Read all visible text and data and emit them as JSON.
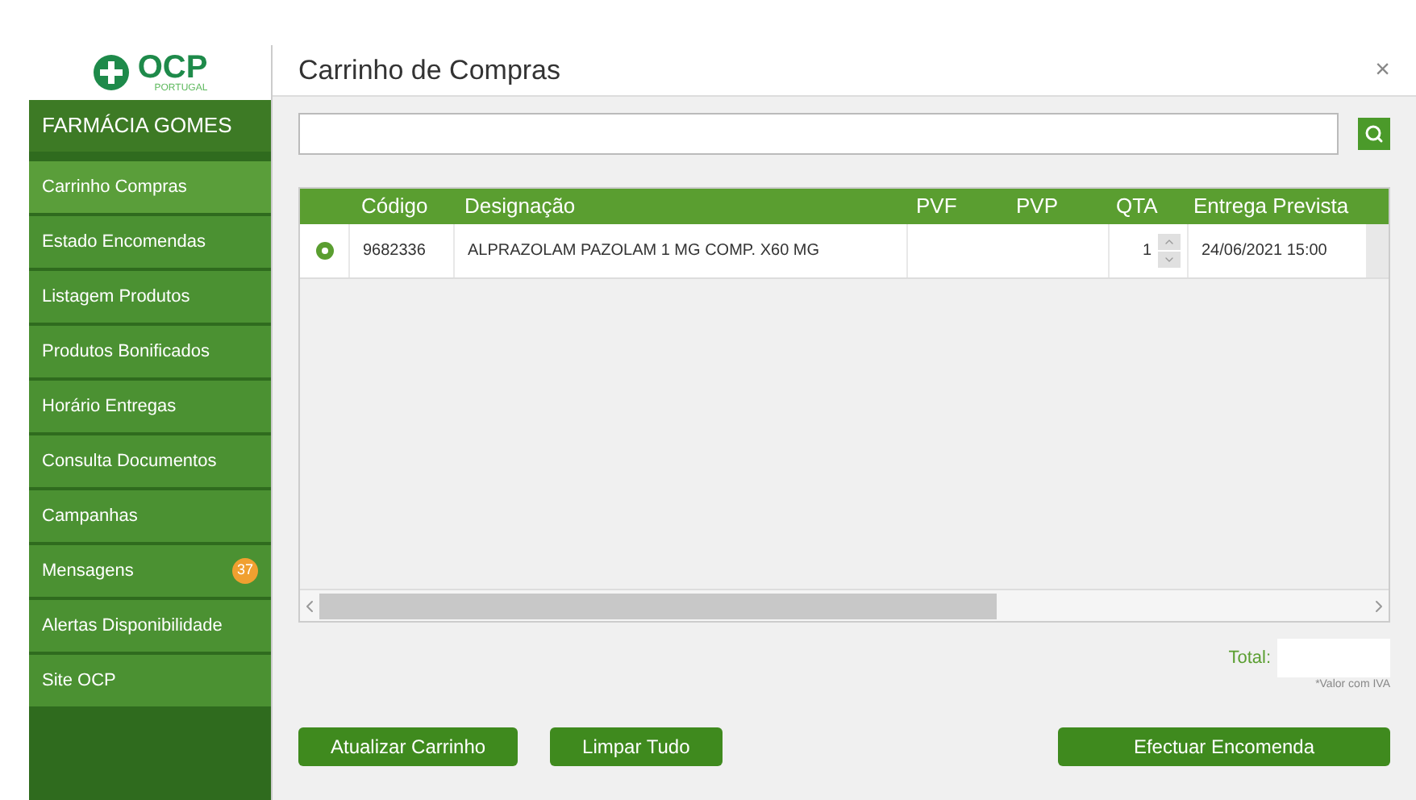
{
  "sidebar": {
    "logo": "OCP",
    "logo_sub": "PORTUGAL",
    "pharmacy": "FARMÁCIA GOMES",
    "items": [
      {
        "label": "Carrinho Compras",
        "selected": true
      },
      {
        "label": "Estado Encomendas",
        "selected": false
      },
      {
        "label": "Listagem Produtos",
        "selected": false
      },
      {
        "label": "Produtos Bonificados",
        "selected": false
      },
      {
        "label": "Horário Entregas",
        "selected": false
      },
      {
        "label": "Consulta Documentos",
        "selected": false
      },
      {
        "label": "Campanhas",
        "selected": false
      },
      {
        "label": "Mensagens",
        "selected": false,
        "badge": "37"
      },
      {
        "label": "Alertas Disponibilidade",
        "selected": false
      },
      {
        "label": "Site OCP",
        "selected": false
      }
    ]
  },
  "dialog": {
    "title": "Carrinho de Compras",
    "close": "×"
  },
  "table": {
    "columns": [
      "Código",
      "Designação",
      "PVF",
      "PVP",
      "QTA",
      "Entrega Prevista"
    ],
    "rows": [
      {
        "code": "9682336",
        "name": "ALPRAZOLAM PAZOLAM 1 MG COMP. X60 MG",
        "qty": "1",
        "delivery": "24/06/2021 15:00"
      }
    ]
  },
  "total": {
    "label": "Total:",
    "note": "*Valor com IVA"
  },
  "buttons": [
    "Atualizar Carrinho",
    "Limpar Tudo",
    "Efectuar Encomenda"
  ]
}
